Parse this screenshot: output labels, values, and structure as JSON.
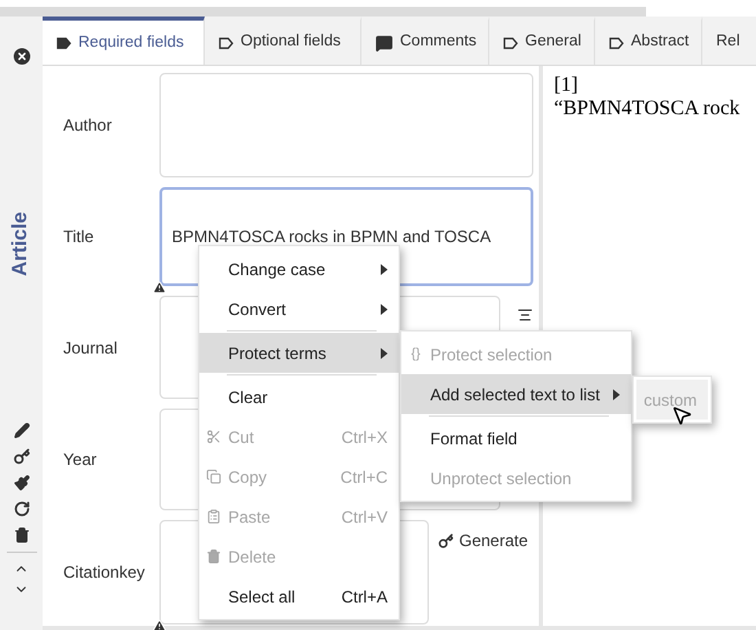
{
  "sidebar": {
    "title": "Article"
  },
  "tabs": [
    {
      "label": "Required fields",
      "selected": true
    },
    {
      "label": "Optional fields",
      "selected": false
    },
    {
      "label": "Comments",
      "selected": false
    },
    {
      "label": "General",
      "selected": false
    },
    {
      "label": "Abstract",
      "selected": false
    },
    {
      "label": "Rel",
      "selected": false
    }
  ],
  "fields": [
    {
      "label": "Author",
      "focused": false,
      "warning": false
    },
    {
      "label": "Title",
      "value": "BPMN4TOSCA rocks in BPMN and TOSCA",
      "focused": true,
      "warning": true
    },
    {
      "label": "Journal",
      "focused": false,
      "warning": false
    },
    {
      "label": "Year",
      "focused": false,
      "warning": false
    },
    {
      "label": "Citationkey",
      "focused": false,
      "warning": true,
      "button": "Generate"
    }
  ],
  "preview": {
    "number": "[1]",
    "text": "“BPMN4TOSCA rock"
  },
  "context_menu": [
    {
      "kind": "item",
      "label": "Change case",
      "submenu": true,
      "disabled": false,
      "selected": false
    },
    {
      "kind": "item",
      "label": "Convert",
      "submenu": true,
      "disabled": false,
      "selected": false
    },
    {
      "kind": "separator"
    },
    {
      "kind": "item",
      "label": "Protect terms",
      "submenu": true,
      "disabled": false,
      "selected": true
    },
    {
      "kind": "separator"
    },
    {
      "kind": "item",
      "label": "Clear",
      "disabled": false,
      "selected": false
    },
    {
      "kind": "item",
      "label": "Cut",
      "shortcut": "Ctrl+X",
      "disabled": true,
      "selected": false
    },
    {
      "kind": "item",
      "label": "Copy",
      "shortcut": "Ctrl+C",
      "disabled": true,
      "selected": false
    },
    {
      "kind": "item",
      "label": "Paste",
      "shortcut": "Ctrl+V",
      "disabled": true,
      "selected": false
    },
    {
      "kind": "item",
      "label": "Delete",
      "disabled": true,
      "selected": false
    },
    {
      "kind": "item",
      "label": "Select all",
      "shortcut": "Ctrl+A",
      "disabled": false,
      "selected": false
    }
  ],
  "submenu": [
    {
      "kind": "item",
      "label": "Protect selection",
      "prefix": "{}",
      "disabled": true,
      "selected": false
    },
    {
      "kind": "item",
      "label": "Add selected text to list",
      "submenu": true,
      "disabled": false,
      "selected": true
    },
    {
      "kind": "separator"
    },
    {
      "kind": "item",
      "label": "Format field",
      "disabled": false,
      "selected": false
    },
    {
      "kind": "item",
      "label": "Unprotect selection",
      "disabled": true,
      "selected": false
    }
  ],
  "list_menu": [
    {
      "kind": "item",
      "label": "custom",
      "disabled": true,
      "selected": true
    }
  ]
}
